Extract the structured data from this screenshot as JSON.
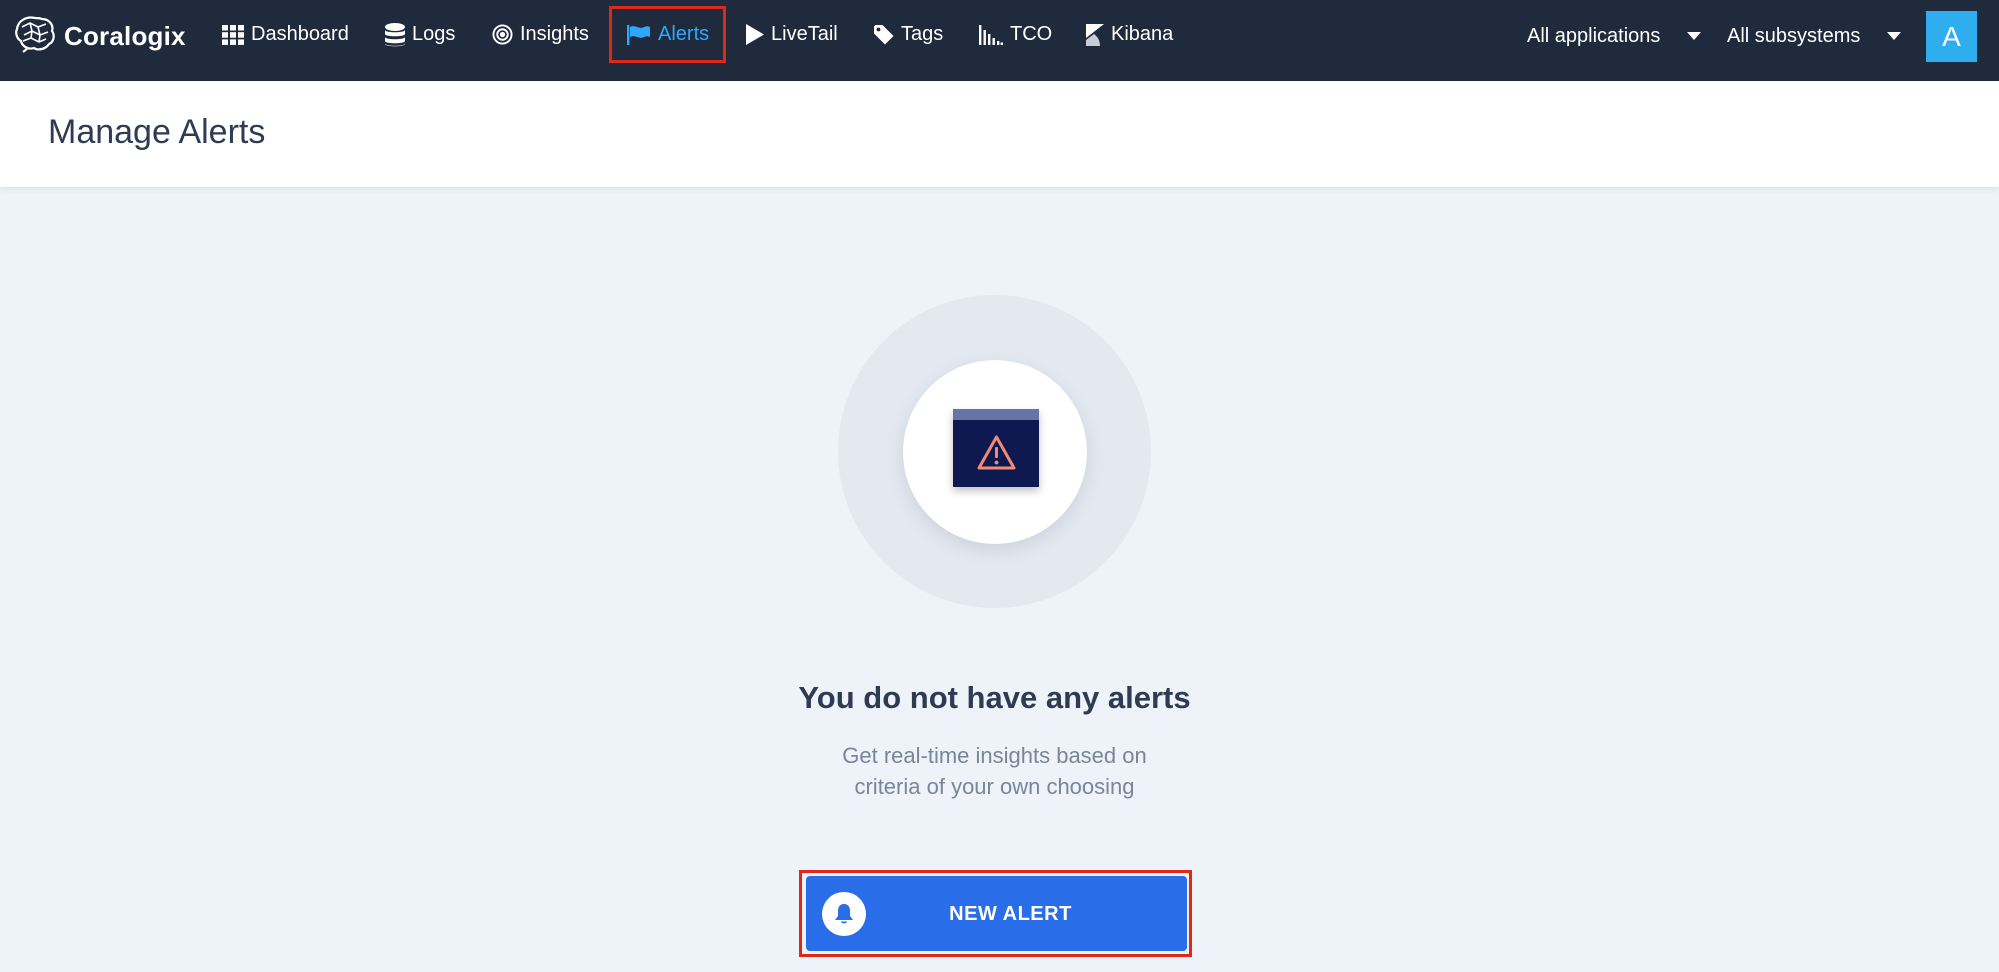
{
  "app": {
    "name": "Coralogix",
    "logo_icon": "brain-logo-icon"
  },
  "nav": {
    "items": [
      {
        "label": "Dashboard",
        "icon": "grid-icon",
        "active": false
      },
      {
        "label": "Logs",
        "icon": "database-icon",
        "active": false
      },
      {
        "label": "Insights",
        "icon": "target-icon",
        "active": false
      },
      {
        "label": "Alerts",
        "icon": "flag-icon",
        "active": true
      },
      {
        "label": "LiveTail",
        "icon": "play-icon",
        "active": false
      },
      {
        "label": "Tags",
        "icon": "tag-icon",
        "active": false
      },
      {
        "label": "TCO",
        "icon": "bar-chart-icon",
        "active": false
      },
      {
        "label": "Kibana",
        "icon": "kibana-icon",
        "active": false
      }
    ],
    "applications_select": "All applications",
    "subsystems_select": "All subsystems",
    "avatar_initial": "A"
  },
  "page": {
    "title": "Manage Alerts"
  },
  "empty_state": {
    "illustration_icon": "warning-window-icon",
    "title": "You do not have any alerts",
    "subtitle_line1": "Get real-time insights based on",
    "subtitle_line2": "criteria of your own choosing",
    "button_label": "NEW ALERT",
    "button_icon": "bell-icon"
  },
  "colors": {
    "topbar_bg": "#1f2a3d",
    "active_nav": "#2ea8ff",
    "primary_button": "#2a6de8",
    "highlight_outline": "#e0281a",
    "avatar_bg": "#2eaeef",
    "page_bg": "#eef2f9"
  }
}
